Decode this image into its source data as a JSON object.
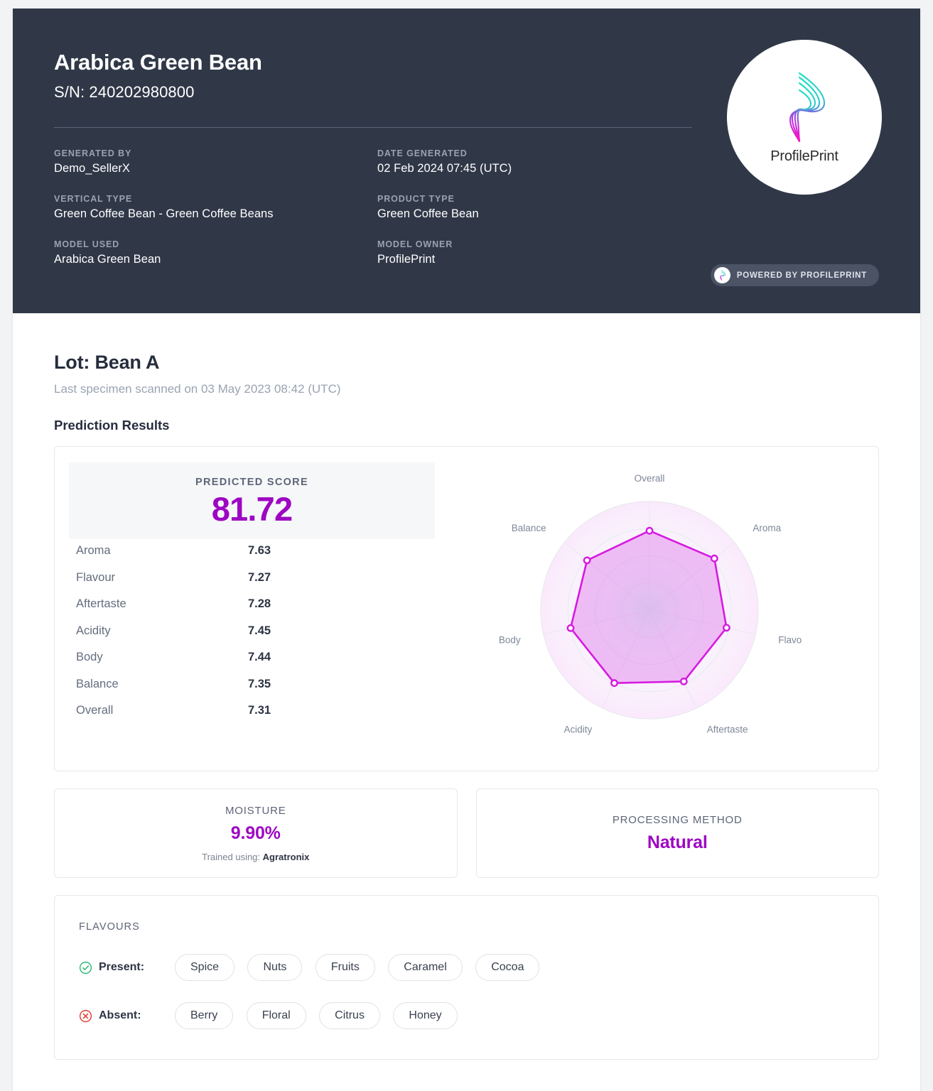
{
  "header": {
    "title": "Arabica Green Bean",
    "serial": "S/N: 240202980800",
    "meta": [
      {
        "label": "GENERATED BY",
        "value": "Demo_SellerX"
      },
      {
        "label": "DATE GENERATED",
        "value": "02 Feb 2024 07:45 (UTC)"
      },
      {
        "label": "VERTICAL TYPE",
        "value": "Green Coffee Bean - Green Coffee Beans"
      },
      {
        "label": "PRODUCT TYPE",
        "value": "Green Coffee Bean"
      },
      {
        "label": "MODEL USED",
        "value": "Arabica Green Bean"
      },
      {
        "label": "MODEL OWNER",
        "value": "ProfilePrint"
      }
    ],
    "logo_word": "ProfilePrint",
    "logo_icon": "profileprint-ribbon-icon",
    "powered_text": "POWERED BY PROFILEPRINT",
    "powered_icon": "profileprint-ribbon-icon"
  },
  "lot": {
    "title": "Lot: Bean A",
    "subtitle": "Last specimen scanned on 03 May 2023 08:42 (UTC)",
    "section_title": "Prediction Results"
  },
  "score": {
    "label": "PREDICTED SCORE",
    "value": "81.72",
    "accent_color": "#9d07c3"
  },
  "attributes": [
    {
      "name": "Aroma",
      "value": "7.63"
    },
    {
      "name": "Flavour",
      "value": "7.27"
    },
    {
      "name": "Aftertaste",
      "value": "7.28"
    },
    {
      "name": "Acidity",
      "value": "7.45"
    },
    {
      "name": "Body",
      "value": "7.44"
    },
    {
      "name": "Balance",
      "value": "7.35"
    },
    {
      "name": "Overall",
      "value": "7.31"
    }
  ],
  "chart_data": {
    "type": "radar",
    "title": "",
    "categories": [
      "Overall",
      "Aroma",
      "Flavour",
      "Aftertaste",
      "Acidity",
      "Body",
      "Balance"
    ],
    "values": [
      7.31,
      7.63,
      7.27,
      7.28,
      7.45,
      7.44,
      7.35
    ],
    "series": [
      {
        "name": "Predicted",
        "values": [
          7.31,
          7.63,
          7.27,
          7.28,
          7.45,
          7.44,
          7.35
        ]
      }
    ],
    "rlim": [
      0,
      10
    ],
    "rings": 4,
    "grid": true,
    "legend": "none",
    "start_angle_deg": -90,
    "direction": "clockwise",
    "line_color": "#d61ae0",
    "fill_color": "rgba(226,120,235,0.45)",
    "center_glow_color": "#7ff2d4",
    "label_color": "#7e8798"
  },
  "moisture": {
    "label": "MOISTURE",
    "value": "9.90%",
    "note_prefix": "Trained using: ",
    "note_value": "Agratronix"
  },
  "processing": {
    "label": "PROCESSING METHOD",
    "value": "Natural"
  },
  "flavours": {
    "title": "FLAVOURS",
    "present_label": "Present:",
    "present_icon": "check-circle-icon",
    "present_color": "#2eb872",
    "present": [
      "Spice",
      "Nuts",
      "Fruits",
      "Caramel",
      "Cocoa"
    ],
    "absent_label": "Absent:",
    "absent_icon": "x-circle-icon",
    "absent_color": "#e03b33",
    "absent": [
      "Berry",
      "Floral",
      "Citrus",
      "Honey"
    ]
  }
}
